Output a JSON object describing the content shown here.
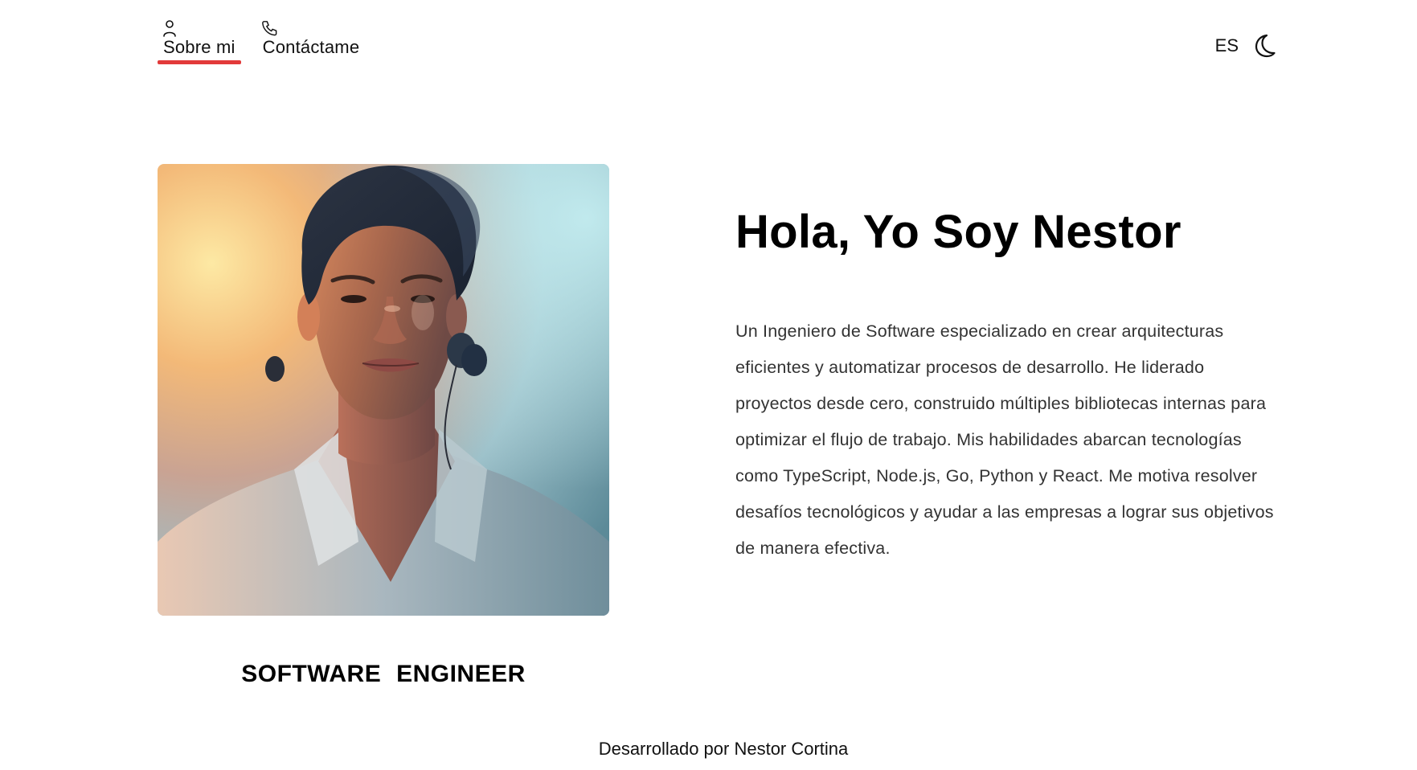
{
  "nav": {
    "items": [
      {
        "label": "Sobre mi",
        "icon": "user-icon",
        "active": true
      },
      {
        "label": "Contáctame",
        "icon": "phone-icon",
        "active": false
      }
    ]
  },
  "header": {
    "language": "ES",
    "theme_icon": "moon-icon"
  },
  "hero": {
    "headline": "Hola, Yo Soy Nestor",
    "bio": "Un Ingeniero de Software especializado en crear arquitecturas eficientes y automatizar procesos de desarrollo. He liderado proyectos desde cero, construido múltiples bibliotecas internas para optimizar el flujo de trabajo. Mis habilidades abarcan tecnologías como TypeScript, Node.js, Go, Python y React. Me motiva resolver desafíos tecnológicos y ayudar a las empresas a lograr sus objetivos de manera efectiva.",
    "role": "SOFTWARE ENGINEER"
  },
  "footer": {
    "credit": "Desarrollado por Nestor Cortina"
  },
  "colors": {
    "accent": "#e23a3a",
    "text": "#111111",
    "background": "#ffffff"
  }
}
